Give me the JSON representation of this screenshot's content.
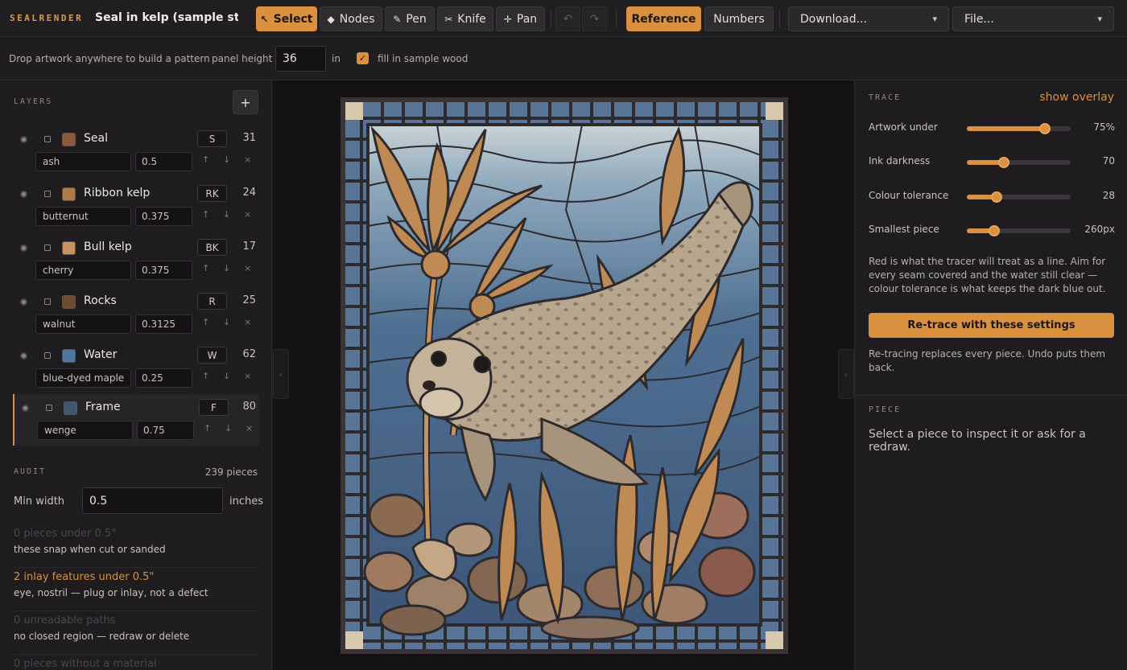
{
  "app": {
    "brand": "SEALRENDER",
    "doc_title": "Seal in kelp (sample stock)"
  },
  "toolbar": {
    "tools": [
      {
        "label": "Select",
        "icon": "↖",
        "active": true
      },
      {
        "label": "Nodes",
        "icon": "◆",
        "active": false
      },
      {
        "label": "Pen",
        "icon": "✎",
        "active": false
      },
      {
        "label": "Knife",
        "icon": "✂",
        "active": false
      },
      {
        "label": "Pan",
        "icon": "✛",
        "active": false
      }
    ],
    "undo_icon": "↶",
    "redo_icon": "↷",
    "reference_label": "Reference",
    "numbers_label": "Numbers",
    "download_label": "Download...",
    "file_label": "File..."
  },
  "subbar": {
    "hint": "Drop artwork anywhere to build a pattern",
    "panel_height_label": "panel height",
    "panel_height_value": "36",
    "panel_height_unit": "in",
    "sample_wood_label": "fill in sample wood",
    "sample_wood_checked": true
  },
  "layers": {
    "heading": "LAYERS",
    "add_label": "+",
    "items": [
      {
        "name": "Seal",
        "code": "S",
        "count": "31",
        "material": "ash",
        "thickness": "0.5",
        "color": "#8a5a3c",
        "selected": false
      },
      {
        "name": "Ribbon kelp",
        "code": "RK",
        "count": "24",
        "material": "butternut",
        "thickness": "0.375",
        "color": "#b07a4c",
        "selected": false
      },
      {
        "name": "Bull kelp",
        "code": "BK",
        "count": "17",
        "material": "cherry",
        "thickness": "0.375",
        "color": "#c9935c",
        "selected": false
      },
      {
        "name": "Rocks",
        "code": "R",
        "count": "25",
        "material": "walnut",
        "thickness": "0.3125",
        "color": "#6e4a2e",
        "selected": false
      },
      {
        "name": "Water",
        "code": "W",
        "count": "62",
        "material": "blue-dyed maple",
        "thickness": "0.25",
        "color": "#4d77a3",
        "selected": false
      },
      {
        "name": "Frame",
        "code": "F",
        "count": "80",
        "material": "wenge",
        "thickness": "0.75",
        "color": "#40556e",
        "selected": true
      }
    ],
    "arrow_up": "↑",
    "arrow_down": "↓",
    "remove": "×"
  },
  "audit": {
    "heading": "AUDIT",
    "count": "239 pieces",
    "min_width_label": "Min width",
    "min_width_value": "0.5",
    "min_width_unit": "inches",
    "items": [
      {
        "title": "0 pieces under 0.5\"",
        "detail": "these snap when cut or sanded",
        "state": "muted"
      },
      {
        "title": "2 inlay features under 0.5\"",
        "detail": "eye, nostril — plug or inlay, not a defect",
        "state": "warn"
      },
      {
        "title": "0 unreadable paths",
        "detail": "no closed region — redraw or delete",
        "state": "muted"
      },
      {
        "title": "0 pieces without a material",
        "detail": "",
        "state": "muted"
      }
    ]
  },
  "trace": {
    "heading": "TRACE",
    "overlay_link": "show overlay",
    "sliders": [
      {
        "label": "Artwork under",
        "value": "75%",
        "level": 0.75
      },
      {
        "label": "Ink darkness",
        "value": "70",
        "level": 0.36
      },
      {
        "label": "Colour tolerance",
        "value": "28",
        "level": 0.29
      },
      {
        "label": "Smallest piece",
        "value": "260px",
        "level": 0.26
      }
    ],
    "explain": "Red is what the tracer will treat as a line. Aim for every seam covered and the water still clear — colour tolerance is what keeps the dark blue out.",
    "retrace_label": "Re-trace with these settings",
    "retrace_note": "Re-tracing replaces every piece. Undo puts them back."
  },
  "piece": {
    "heading": "PIECE",
    "message": "Select a piece to inspect it or ask for a redraw."
  },
  "canvas": {
    "collapse_left_icon": "‹",
    "collapse_right_icon": "›"
  }
}
